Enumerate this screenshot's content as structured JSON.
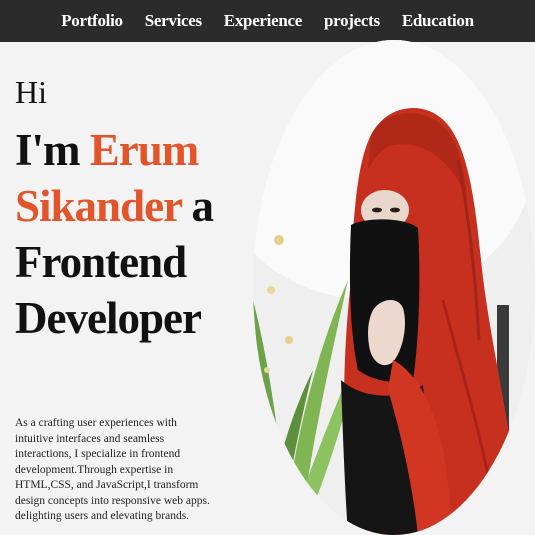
{
  "nav": {
    "items": [
      {
        "label": "Portfolio"
      },
      {
        "label": "Services"
      },
      {
        "label": "Experience"
      },
      {
        "label": "projects"
      },
      {
        "label": "Education"
      }
    ]
  },
  "hero": {
    "greeting": "Hi",
    "intro_prefix": "I'm",
    "name_first": "Erum",
    "name_last": "Sikander",
    "role_prefix": "a",
    "role_line1": "Frontend",
    "role_line2": "Developer",
    "description": "As a crafting user experiences with intuitive interfaces and seamless interactions, I specialize in frontend development.Through expertise in HTML,CSS, and JavaScript,I transform design concepts into responsive web apps. delighting users and elevating brands."
  },
  "colors": {
    "accent": "#e2542a",
    "navbar": "#2b2b2b",
    "background": "#f3f3f3"
  }
}
